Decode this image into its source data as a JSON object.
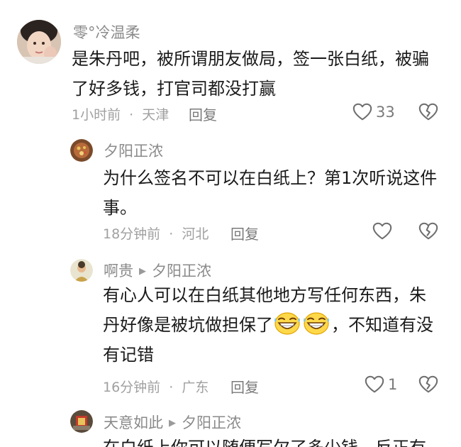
{
  "comments": [
    {
      "username": "零°冷温柔",
      "text_lines": [
        "是朱丹吧，被所谓朋友做局，签一张白纸，被骗",
        "了好多钱，打官司都没打赢"
      ],
      "time": "1小时前",
      "location": "天津",
      "reply_label": "回复",
      "likes": "33"
    },
    {
      "username": "夕阳正浓",
      "text_lines": [
        "为什么签名不可以在白纸上？第1次听说这件",
        "事。"
      ],
      "time": "18分钟前",
      "location": "河北",
      "reply_label": "回复",
      "likes": ""
    },
    {
      "username": "啊贵",
      "reply_to": "夕阳正浓",
      "text_lines": [
        "有心人可以在白纸其他地方写任何东西，朱",
        "丹好像是被坑做担保了",
        "，不知道有没",
        "有记错"
      ],
      "time": "16分钟前",
      "location": "广东",
      "reply_label": "回复",
      "likes": "1"
    },
    {
      "username": "天意如此",
      "reply_to": "夕阳正浓",
      "text_lines": [
        "在白纸上你可以随便写欠了多少钱，反正有"
      ]
    }
  ],
  "separator": "·",
  "icons": {
    "like": "heart-outline-icon",
    "dislike": "broken-heart-icon",
    "reply_arrow": "triangle-right-icon",
    "emoji": "grinning-sweat-emoji"
  },
  "colors": {
    "username": "#8a8a8a",
    "text": "#1a1a1a",
    "meta": "#a0a0a0"
  }
}
